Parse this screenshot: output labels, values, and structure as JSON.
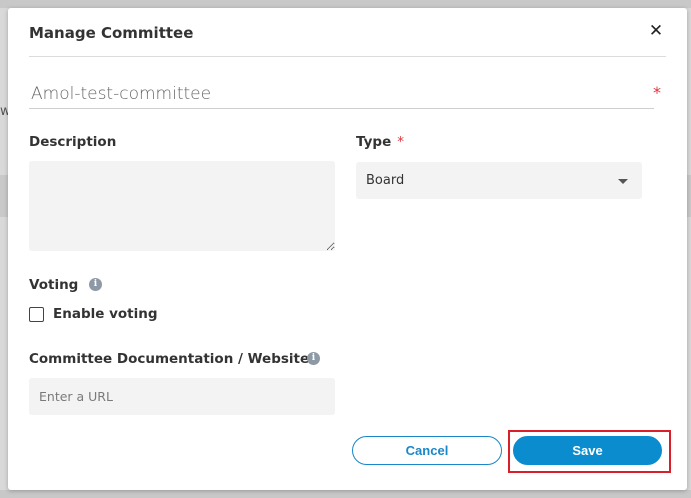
{
  "background": {
    "partial_text": "w"
  },
  "modal": {
    "title": "Manage Committee",
    "close_glyph": "✕"
  },
  "form": {
    "name": {
      "value": "Amol-test-committee",
      "required_mark": "*"
    },
    "description": {
      "label": "Description",
      "value": ""
    },
    "type": {
      "label": "Type",
      "required_mark": "*",
      "selected": "Board"
    },
    "voting": {
      "label": "Voting",
      "info_glyph": "i",
      "checkbox_label": "Enable voting",
      "checked": false
    },
    "documentation": {
      "label": "Committee Documentation / Website",
      "info_glyph": "i",
      "placeholder": "Enter a URL",
      "value": ""
    }
  },
  "actions": {
    "cancel_label": "Cancel",
    "save_label": "Save"
  },
  "colors": {
    "primary": "#0a8ccf",
    "required": "#e0333d",
    "highlight": "#d9202a"
  },
  "icons": {
    "close": "close-icon",
    "info": "info-icon",
    "dropdown": "chevron-down-icon"
  }
}
